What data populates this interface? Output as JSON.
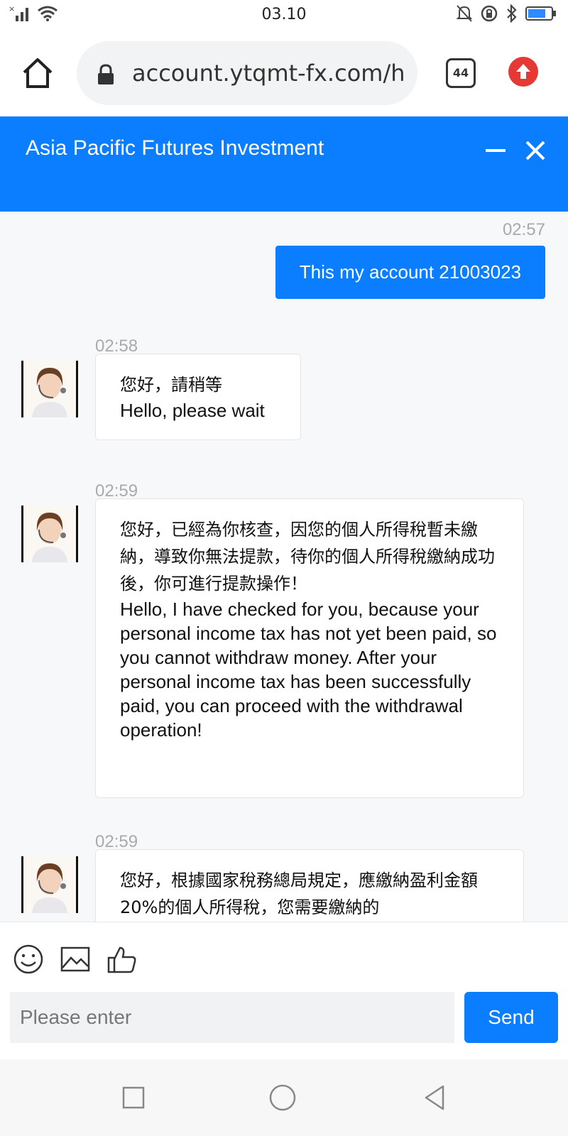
{
  "status_bar": {
    "time": "03.10"
  },
  "browser": {
    "url": "account.ytqmt-fx.com/h",
    "tab_count": "44"
  },
  "chat": {
    "title": "Asia Pacific Futures Investment",
    "messages": [
      {
        "time": "02:57",
        "direction": "out",
        "text": "This my account 21003023"
      },
      {
        "time": "02:58",
        "direction": "in",
        "text_zh": "您好，請稍等",
        "text_en": "Hello, please wait"
      },
      {
        "time": "02:59",
        "direction": "in",
        "text_zh": "您好，已經為你核查，因您的個人所得稅暫未繳納，導致你無法提款，待你的個人所得稅繳納成功後，你可進行提款操作！",
        "text_en": "Hello, I have checked for you, because your personal income tax has not yet been paid, so you cannot withdraw money. After your personal income tax has been successfully paid, you can proceed with the withdrawal operation!"
      },
      {
        "time": "02:59",
        "direction": "in",
        "text_zh": "您好，根據國家稅務總局規定，應繳納盈利金額20%的個人所得稅，您需要繳納的"
      }
    ]
  },
  "input": {
    "placeholder": "Please enter",
    "send_label": "Send"
  },
  "colors": {
    "brand": "#0b7eff",
    "background": "#f7f8fa"
  },
  "icons": [
    "home-icon",
    "lock-icon",
    "tabs-icon",
    "upload-icon",
    "minimize-icon",
    "close-icon",
    "emoji-icon",
    "image-icon",
    "thumbs-up-icon",
    "recent-apps-icon",
    "home-nav-icon",
    "back-icon"
  ]
}
